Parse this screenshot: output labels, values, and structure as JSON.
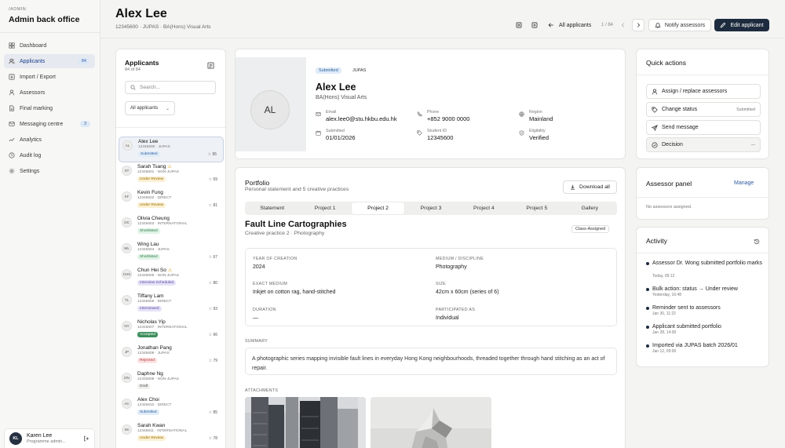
{
  "sidebar": {
    "brand_small": "/ADMIN",
    "brand": "Admin back office",
    "items": [
      {
        "label": "Dashboard",
        "icon": "grid-icon"
      },
      {
        "label": "Applicants",
        "icon": "users-icon",
        "badge": "84"
      },
      {
        "label": "Import / Export",
        "icon": "import-icon"
      },
      {
        "label": "Assessors",
        "icon": "user-icon"
      },
      {
        "label": "Final marking",
        "icon": "file-icon"
      },
      {
        "label": "Messaging centre",
        "icon": "mail-icon",
        "badge": "3"
      },
      {
        "label": "Analytics",
        "icon": "analytics-icon"
      },
      {
        "label": "Audit log",
        "icon": "clock-icon"
      },
      {
        "label": "Settings",
        "icon": "gear-icon"
      }
    ],
    "user": {
      "initials": "KL",
      "name": "Karen Lee",
      "role": "Programme admin..."
    }
  },
  "header": {
    "title": "Alex Lee",
    "subtitle": "12345600 · JUPAS · BA(Hons) Visual Arts",
    "all_applicants": "All applicants",
    "pager": "1 / 84",
    "notify": "Notify assessors",
    "edit": "Edit applicant"
  },
  "applicants_panel": {
    "title": "Applicants",
    "count": "84 of 84",
    "search_placeholder": "Search...",
    "filter": "All applicants",
    "rows": [
      {
        "initials": "AL",
        "name": "Alex Lee",
        "meta": "12345600 · JUPAS",
        "status": "Submitted",
        "score": "95",
        "flag": false
      },
      {
        "initials": "ST",
        "name": "Sarah Tsang",
        "meta": "12345601 · NON-JUPAS",
        "status": "Under Review",
        "score": "69",
        "flag": true
      },
      {
        "initials": "KF",
        "name": "Kevin Fung",
        "meta": "12345602 · DIRECT",
        "status": "Under Review",
        "score": "81",
        "flag": false
      },
      {
        "initials": "OC",
        "name": "Olivia Cheung",
        "meta": "12345603 · INTERNATIONAL",
        "status": "Shortlisted",
        "score": "",
        "flag": false
      },
      {
        "initials": "WL",
        "name": "Wing Lau",
        "meta": "12345604 · JUPAS",
        "status": "Shortlisted",
        "score": "67",
        "flag": false
      },
      {
        "initials": "CHS",
        "name": "Chun Hei So",
        "meta": "12345605 · NON-JUPAS",
        "status": "Interview Scheduled",
        "score": "80",
        "flag": true
      },
      {
        "initials": "TL",
        "name": "Tiffany Lam",
        "meta": "12345606 · DIRECT",
        "status": "Interviewed",
        "score": "93",
        "flag": false
      },
      {
        "initials": "NY",
        "name": "Nicholas Yip",
        "meta": "12345607 · INTERNATIONAL",
        "status": "Accepted",
        "score": "66",
        "flag": false
      },
      {
        "initials": "JP",
        "name": "Jonathan Pang",
        "meta": "12345608 · JUPAS",
        "status": "Rejected",
        "score": "79",
        "flag": false
      },
      {
        "initials": "DN",
        "name": "Daphne Ng",
        "meta": "12345609 · NON-JUPAS",
        "status": "Draft",
        "score": "",
        "flag": false
      },
      {
        "initials": "AC",
        "name": "Alex Choi",
        "meta": "12345610 · DIRECT",
        "status": "Submitted",
        "score": "85",
        "flag": false
      },
      {
        "initials": "SK",
        "name": "Sarah Kwan",
        "meta": "12345611 · INTERNATIONAL",
        "status": "Under Review",
        "score": "78",
        "flag": false
      }
    ]
  },
  "profile": {
    "initials": "AL",
    "status": "Submitted",
    "route": "JUPAS",
    "name": "Alex Lee",
    "degree": "BA(Hons) Visual Arts",
    "fields": [
      {
        "label": "Email",
        "value": "alex.lee0@stu.hkbu.edu.hk",
        "icon": "mail-icon"
      },
      {
        "label": "Phone",
        "value": "+852 9000 0000",
        "icon": "phone-icon"
      },
      {
        "label": "Region",
        "value": "Mainland",
        "icon": "globe-icon"
      },
      {
        "label": "Submitted",
        "value": "01/01/2026",
        "icon": "calendar-icon"
      },
      {
        "label": "Student ID",
        "value": "12345600",
        "icon": "tag-icon"
      },
      {
        "label": "Eligibility",
        "value": "Verified",
        "icon": "shield-icon"
      }
    ]
  },
  "portfolio": {
    "title": "Portfolio",
    "subtitle": "Personal statement and 5 creative practices",
    "download": "Download all",
    "tabs": [
      "Statement",
      "Project 1",
      "Project 2",
      "Project 3",
      "Project 4",
      "Project 5",
      "Gallery"
    ],
    "active_tab": 2,
    "project_title": "Fault Line Cartographies",
    "project_sub": "Creative practice 2 · Photography",
    "project_tag": "Class-Assigned",
    "meta": [
      {
        "label": "YEAR OF CREATION",
        "value": "2024"
      },
      {
        "label": "MEDIUM / DISCIPLINE",
        "value": "Photography"
      },
      {
        "label": "EXACT MEDIUM",
        "value": "Inkjet on cotton rag, hand-stitched"
      },
      {
        "label": "SIZE",
        "value": "42cm x 60cm (series of 6)"
      },
      {
        "label": "DURATION",
        "value": "—"
      },
      {
        "label": "PARTICIPATED AS",
        "value": "Individual"
      }
    ],
    "summary_label": "SUMMARY",
    "summary": "A photographic series mapping invisible fault lines in everyday Hong Kong neighbourhoods, threaded together through hand stitching as an act of repair.",
    "attachments_label": "ATTACHMENTS"
  },
  "quick_actions": {
    "title": "Quick actions",
    "items": [
      {
        "label": "Assign / replace assessors",
        "icon": "user-icon",
        "right": ""
      },
      {
        "label": "Change status",
        "icon": "tag-icon",
        "right": "Submitted"
      },
      {
        "label": "Send message",
        "icon": "send-icon",
        "right": ""
      },
      {
        "label": "Decision",
        "icon": "check-circle-icon",
        "right": "—"
      }
    ]
  },
  "assessor_panel": {
    "title": "Assessor panel",
    "manage": "Manage",
    "empty": "No assessors assigned."
  },
  "activity": {
    "title": "Activity",
    "items": [
      {
        "text": "Assessor Dr. Wong submitted portfolio marks",
        "time": "Today, 09:12"
      },
      {
        "text": "Bulk action: status → Under review",
        "time": "Yesterday, 16:48"
      },
      {
        "text": "Reminder sent to assessors",
        "time": "Jan 30, 11:22"
      },
      {
        "text": "Applicant submitted portfolio",
        "time": "Jan 28, 14:00"
      },
      {
        "text": "Imported via JUPAS batch 2026/01",
        "time": "Jan 12, 09:00"
      }
    ]
  },
  "colors": {
    "primary": "#1d2b3e",
    "accent_link": "#2f5ba0",
    "badge_submitted_bg": "#e0ecf8",
    "badge_review_bg": "#fbf0d2",
    "badge_shortlisted_bg": "#e0f3e6",
    "badge_accepted_bg": "#3e8f5c",
    "badge_rejected_bg": "#fbe2e2"
  }
}
